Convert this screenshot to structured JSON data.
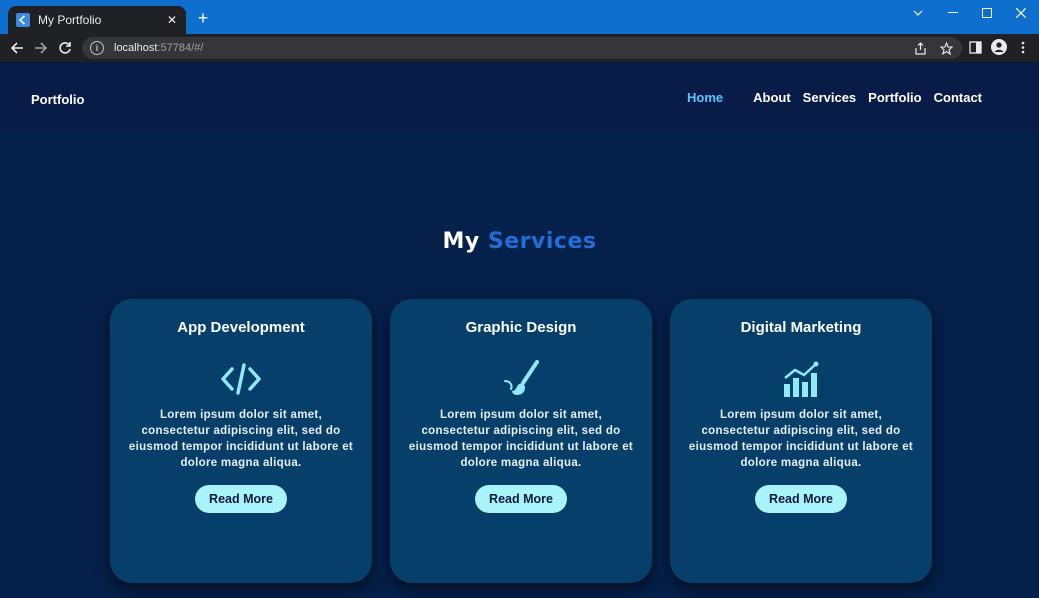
{
  "browser": {
    "tab_title": "My Portfolio",
    "new_tab_label": "+",
    "url_host": "localhost",
    "url_rest": ":57784/#/"
  },
  "site": {
    "brand": "Portfolio",
    "nav": [
      {
        "label": "Home"
      },
      {
        "label": "About"
      },
      {
        "label": "Services"
      },
      {
        "label": "Portfolio"
      },
      {
        "label": "Contact"
      }
    ]
  },
  "services": {
    "title_part1": "My",
    "title_part2": "Services",
    "cards": [
      {
        "title": "App Development",
        "icon": "code-icon",
        "text": "Lorem ipsum dolor sit amet, consectetur adipiscing elit, sed do eiusmod tempor incididunt ut labore et dolore magna aliqua.",
        "button": "Read More"
      },
      {
        "title": "Graphic Design",
        "icon": "paintbrush-icon",
        "text": "Lorem ipsum dolor sit amet, consectetur adipiscing elit, sed do eiusmod tempor incididunt ut labore et dolore magna aliqua.",
        "button": "Read More"
      },
      {
        "title": "Digital Marketing",
        "icon": "chart-growth-icon",
        "text": "Lorem ipsum dolor sit amet, consectetur adipiscing elit, sed do eiusmod tempor incididunt ut labore et dolore magna aliqua.",
        "button": "Read More"
      }
    ]
  },
  "colors": {
    "accent": "#58c8ff",
    "title_accent": "#1e6fd6",
    "card_bg": "#073f6b",
    "button_bg": "#a9f4fb"
  }
}
